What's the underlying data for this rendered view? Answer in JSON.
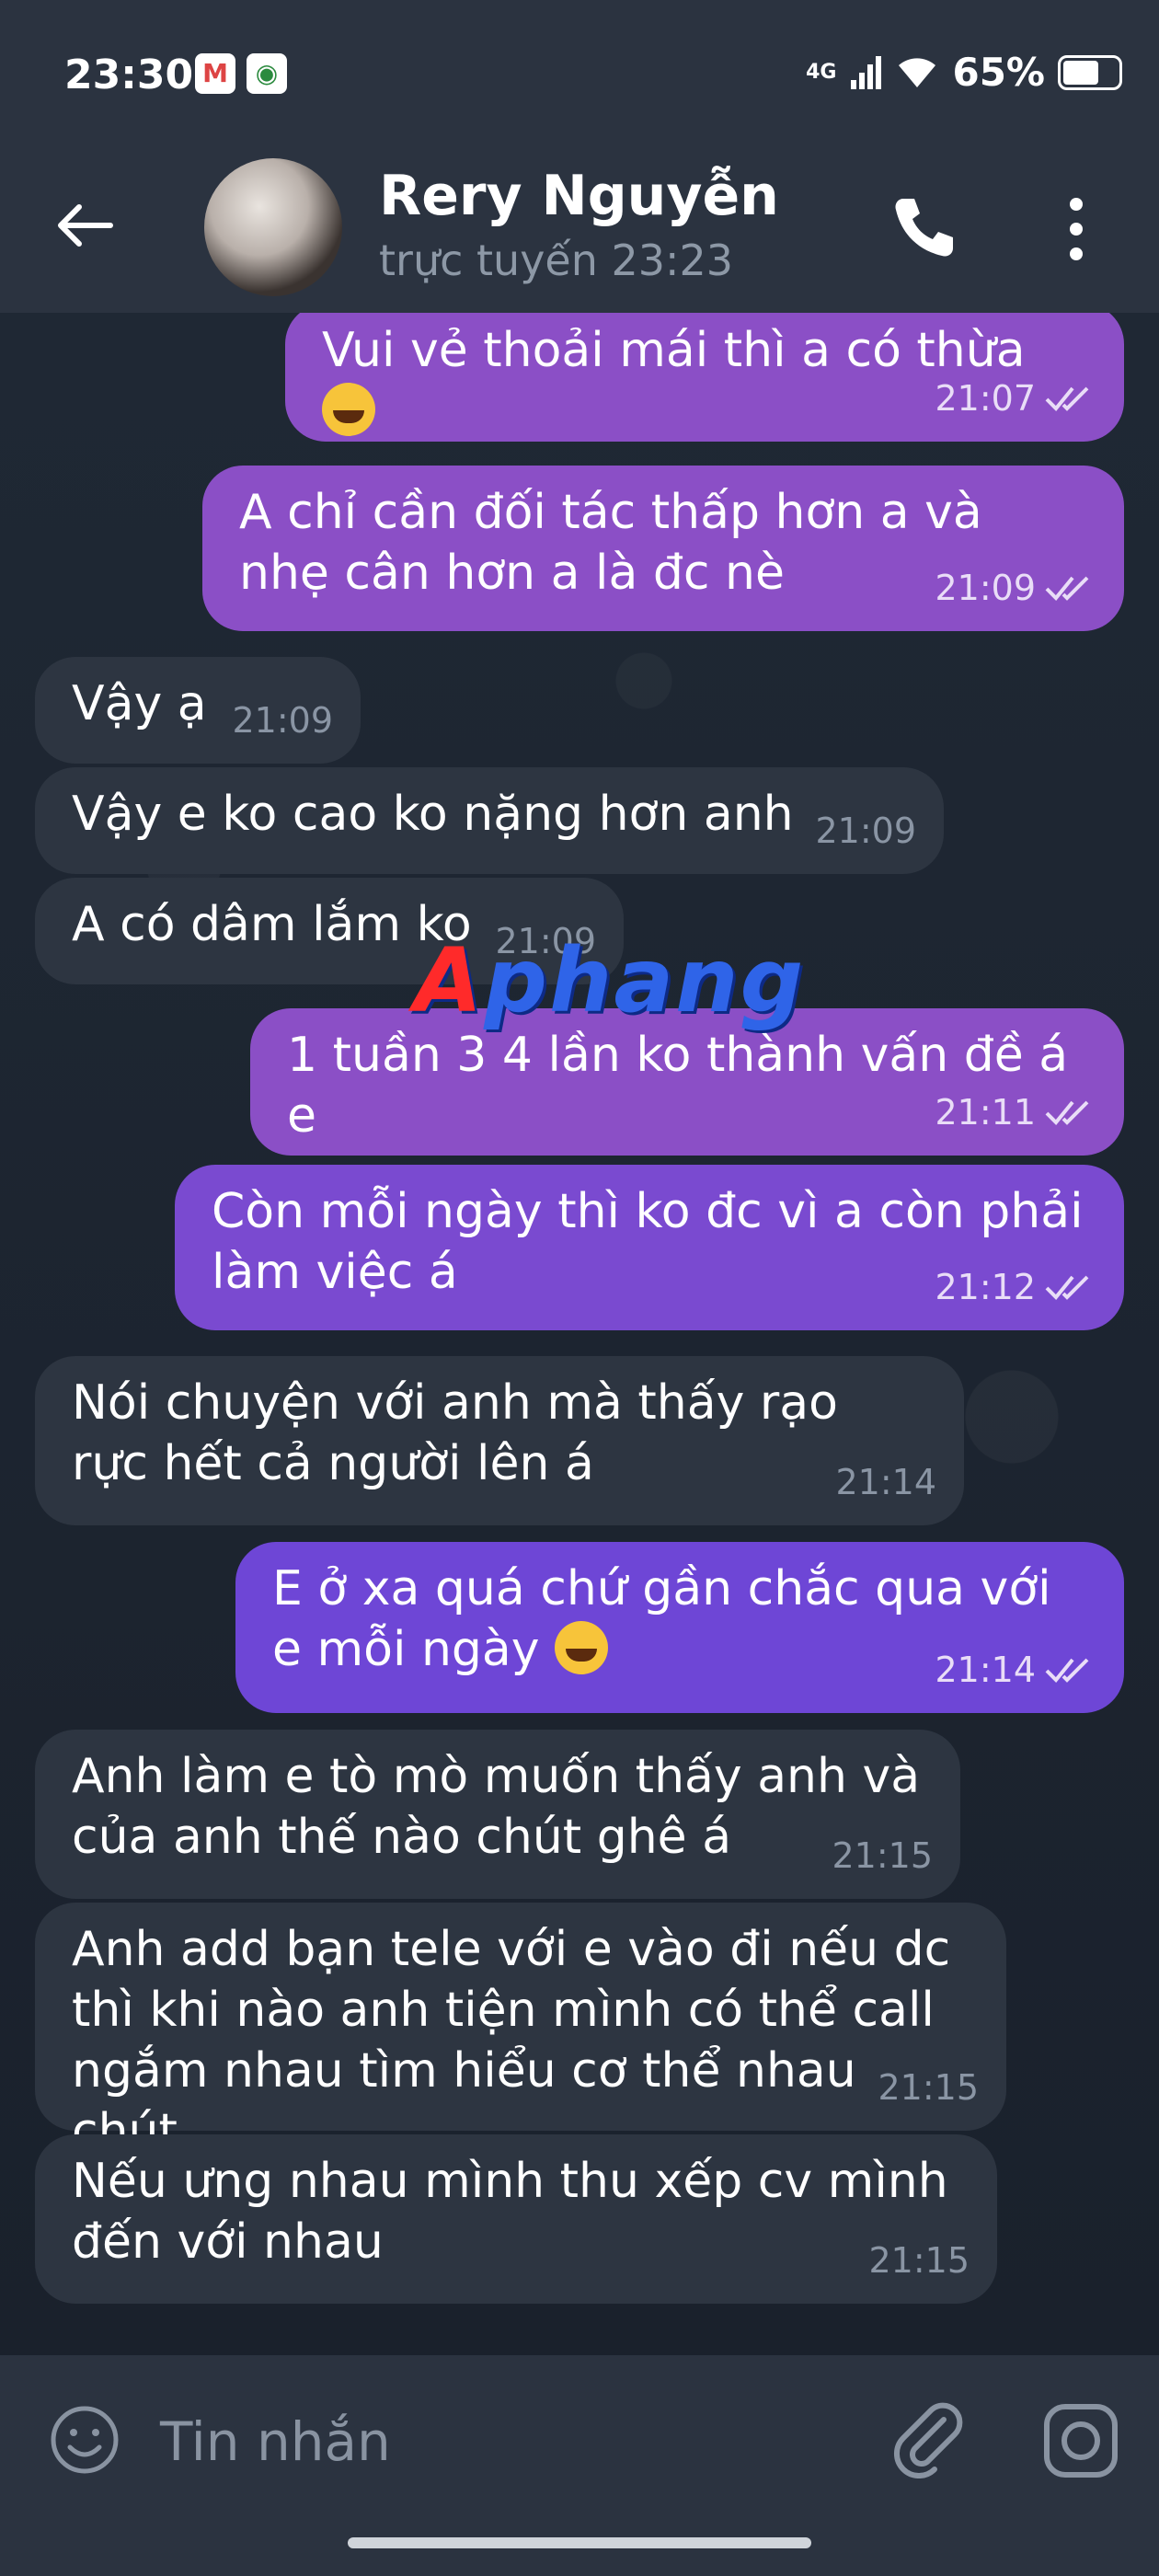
{
  "status_bar": {
    "time": "23:30",
    "battery": "65%",
    "network": "4G",
    "battery_level": 0.65
  },
  "header": {
    "contact_name": "Rery Nguyễn",
    "presence": "trực tuyến 23:23"
  },
  "messages": [
    {
      "dir": "out",
      "text": "Vui vẻ thoải mái thì a có thừa",
      "emoji": true,
      "time": "21:07"
    },
    {
      "dir": "out",
      "text": "A chỉ cần đối tác thấp hơn a và nhẹ cân hơn a là đc nè",
      "time": "21:09"
    },
    {
      "dir": "in",
      "text": "Vậy ạ",
      "time": "21:09"
    },
    {
      "dir": "in",
      "text": "Vậy e ko cao ko nặng hơn anh",
      "time": "21:09"
    },
    {
      "dir": "in",
      "text": "A có dâm lắm ko",
      "time": "21:09"
    },
    {
      "dir": "out",
      "text": "1 tuần 3 4 lần ko thành vấn đề á e",
      "time": "21:11"
    },
    {
      "dir": "out",
      "text": "Còn mỗi ngày thì ko đc vì a còn phải làm việc á",
      "time": "21:12"
    },
    {
      "dir": "in",
      "text": "Nói chuyện với anh mà thấy rạo rực hết cả người lên á",
      "time": "21:14"
    },
    {
      "dir": "out",
      "text": "E ở xa quá chứ gần chắc qua với e mỗi ngày",
      "emoji": true,
      "time": "21:14"
    },
    {
      "dir": "in",
      "text": "Anh làm e tò mò muốn thấy anh và của anh thế nào chút ghê á",
      "time": "21:15"
    },
    {
      "dir": "in",
      "text": "Anh add bạn tele với e vào đi nếu dc thì khi nào anh tiện mình có thể call ngắm nhau tìm hiểu cơ thể nhau chút",
      "time": "21:15"
    },
    {
      "dir": "in",
      "text": "Nếu ưng nhau mình thu xếp cv mình đến với nhau",
      "time": "21:15"
    }
  ],
  "watermark": {
    "first": "A",
    "rest": "phang"
  },
  "composer": {
    "placeholder": "Tin nhắn"
  },
  "icons": {
    "back": "arrow-left-icon",
    "call": "phone-icon",
    "more": "more-vert-icon",
    "emoji": "smile-icon",
    "attach": "paperclip-icon",
    "camera": "instagram-camera-icon",
    "gmail": "gmail-icon",
    "chrome": "chrome-icon"
  },
  "colors": {
    "outgoing": "#8b4fc6",
    "incoming": "#2d3541",
    "background": "#1c2430",
    "bar": "#2b3340"
  }
}
